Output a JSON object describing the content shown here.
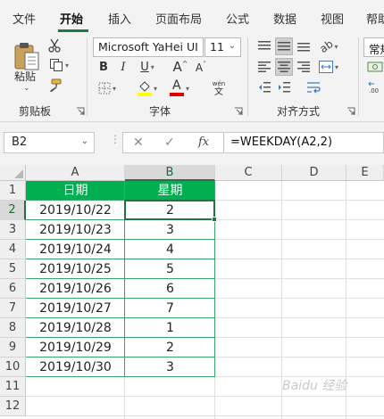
{
  "menu": {
    "tabs": [
      {
        "label": "文件"
      },
      {
        "label": "开始"
      },
      {
        "label": "插入"
      },
      {
        "label": "页面布局"
      },
      {
        "label": "公式"
      },
      {
        "label": "数据"
      },
      {
        "label": "视图"
      },
      {
        "label": "帮助"
      }
    ],
    "active_tab": "开始"
  },
  "ribbon": {
    "clipboard": {
      "paste_label": "粘贴",
      "group_label": "剪贴板"
    },
    "font": {
      "font_name": "Microsoft YaHei UI",
      "font_size": "11",
      "bold": "B",
      "italic": "I",
      "underline": "U",
      "grow_font": "A",
      "shrink_font": "A",
      "phonetic_top": "wén",
      "phonetic_bottom": "文",
      "font_color_letter": "A",
      "group_label": "字体",
      "highlight_color": "#ffff00",
      "font_color": "#e00000"
    },
    "alignment": {
      "group_label": "对齐方式"
    },
    "number": {
      "format": "常规"
    }
  },
  "formula_bar": {
    "name_box": "B2",
    "cancel_symbol": "✕",
    "enter_symbol": "✓",
    "fx_symbol": "fx",
    "formula": "=WEEKDAY(A2,2)"
  },
  "sheet": {
    "columns": [
      "A",
      "B",
      "C",
      "D",
      "E"
    ],
    "rows": [
      "1",
      "2",
      "3",
      "4",
      "5",
      "6",
      "7",
      "8",
      "9",
      "10",
      "11",
      "12"
    ],
    "selected_cell": "B2",
    "header_fill": "#00b050",
    "header": [
      "日期",
      "星期"
    ],
    "data": [
      [
        "2019/10/22",
        "2"
      ],
      [
        "2019/10/23",
        "3"
      ],
      [
        "2019/10/24",
        "4"
      ],
      [
        "2019/10/25",
        "5"
      ],
      [
        "2019/10/26",
        "6"
      ],
      [
        "2019/10/27",
        "7"
      ],
      [
        "2019/10/28",
        "1"
      ],
      [
        "2019/10/29",
        "2"
      ],
      [
        "2019/10/30",
        "3"
      ]
    ]
  },
  "watermark": "Baidu 经验"
}
